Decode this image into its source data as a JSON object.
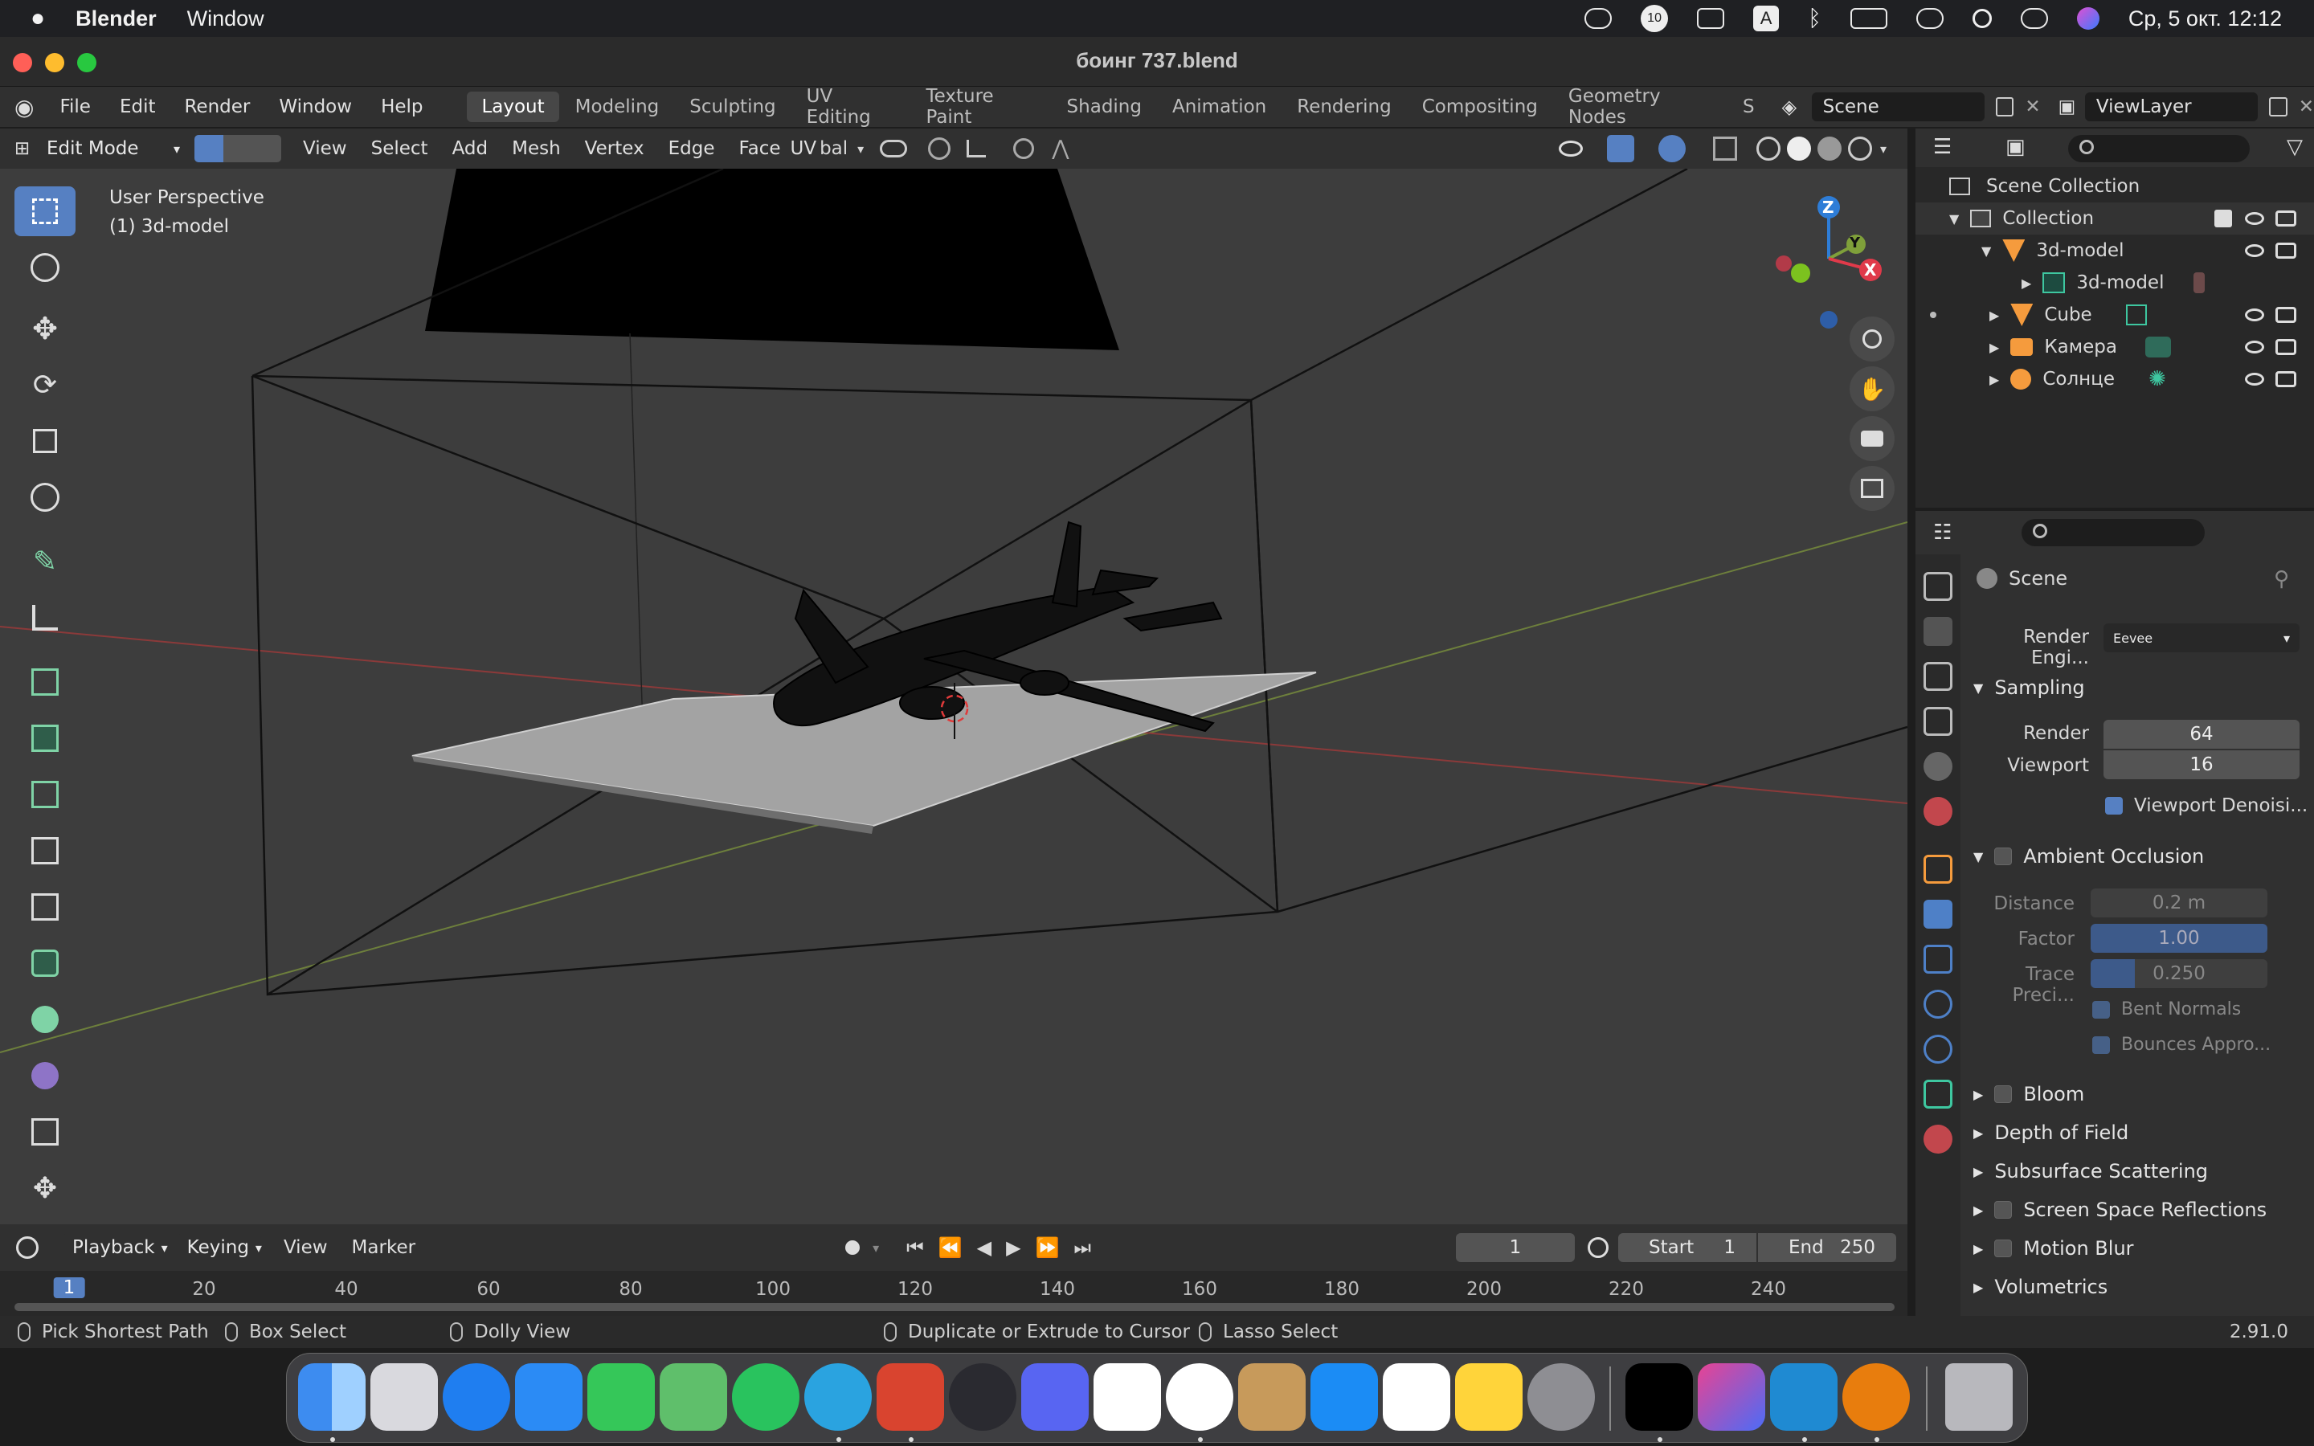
{
  "menubar": {
    "app_name": "Blender",
    "menu": [
      "Window"
    ],
    "clock": "Ср, 5 окт.  12:12",
    "input_source": "A",
    "notification_count": "10"
  },
  "window": {
    "title": "боинг 737.blend"
  },
  "topbar": {
    "menus": [
      "File",
      "Edit",
      "Render",
      "Window",
      "Help"
    ],
    "workspaces": [
      "Layout",
      "Modeling",
      "Sculpting",
      "UV Editing",
      "Texture Paint",
      "Shading",
      "Animation",
      "Rendering",
      "Compositing",
      "Geometry Nodes",
      "S"
    ],
    "active_workspace": "Layout",
    "scene": "Scene",
    "view_layer": "ViewLayer"
  },
  "viewport_header": {
    "mode": "Edit Mode",
    "menus": [
      "View",
      "Select",
      "Add",
      "Mesh",
      "Vertex",
      "Edge",
      "Face",
      "UV"
    ],
    "transform_orientation": "bal"
  },
  "viewport": {
    "overlay_line1": "User Perspective",
    "overlay_line2": "(1) 3d-model",
    "gizmo": {
      "z": "Z",
      "y": "Y",
      "x": "X"
    }
  },
  "timeline": {
    "menus": [
      "Playback",
      "Keying",
      "View",
      "Marker"
    ],
    "current_frame": "1",
    "start_label": "Start",
    "start_value": "1",
    "end_label": "End",
    "end_value": "250",
    "ticks": [
      "1",
      "20",
      "40",
      "60",
      "80",
      "100",
      "120",
      "140",
      "160",
      "180",
      "200",
      "220",
      "240"
    ]
  },
  "statusbar": {
    "items": [
      "Pick Shortest Path",
      "Box Select",
      "Dolly View",
      "Duplicate or Extrude to Cursor",
      "Lasso Select"
    ],
    "version": "2.91.0"
  },
  "outliner": {
    "root": "Scene Collection",
    "collection": "Collection",
    "items": [
      {
        "label": "3d-model",
        "indent": 1
      },
      {
        "label": "3d-model",
        "indent": 2
      },
      {
        "label": "Cube",
        "indent": 1
      },
      {
        "label": "Камера",
        "indent": 1
      },
      {
        "label": "Солнце",
        "indent": 1
      }
    ]
  },
  "properties": {
    "context": "Scene",
    "render_engine_label": "Render Engi...",
    "render_engine": "Eevee",
    "sampling": {
      "title": "Sampling",
      "render_label": "Render",
      "render": "64",
      "viewport_label": "Viewport",
      "viewport": "16",
      "denoise_label": "Viewport Denoisi..."
    },
    "ao": {
      "title": "Ambient Occlusion",
      "distance_label": "Distance",
      "distance": "0.2 m",
      "factor_label": "Factor",
      "factor": "1.00",
      "trace_label": "Trace Preci...",
      "trace": "0.250",
      "bent_label": "Bent Normals",
      "bounces_label": "Bounces Appro..."
    },
    "sections": [
      "Bloom",
      "Depth of Field",
      "Subsurface Scattering",
      "Screen Space Reflections",
      "Motion Blur",
      "Volumetrics"
    ]
  },
  "colors": {
    "accent": "#5680c2",
    "viewport_bg": "#3d3d3d",
    "panel": "#303030"
  }
}
